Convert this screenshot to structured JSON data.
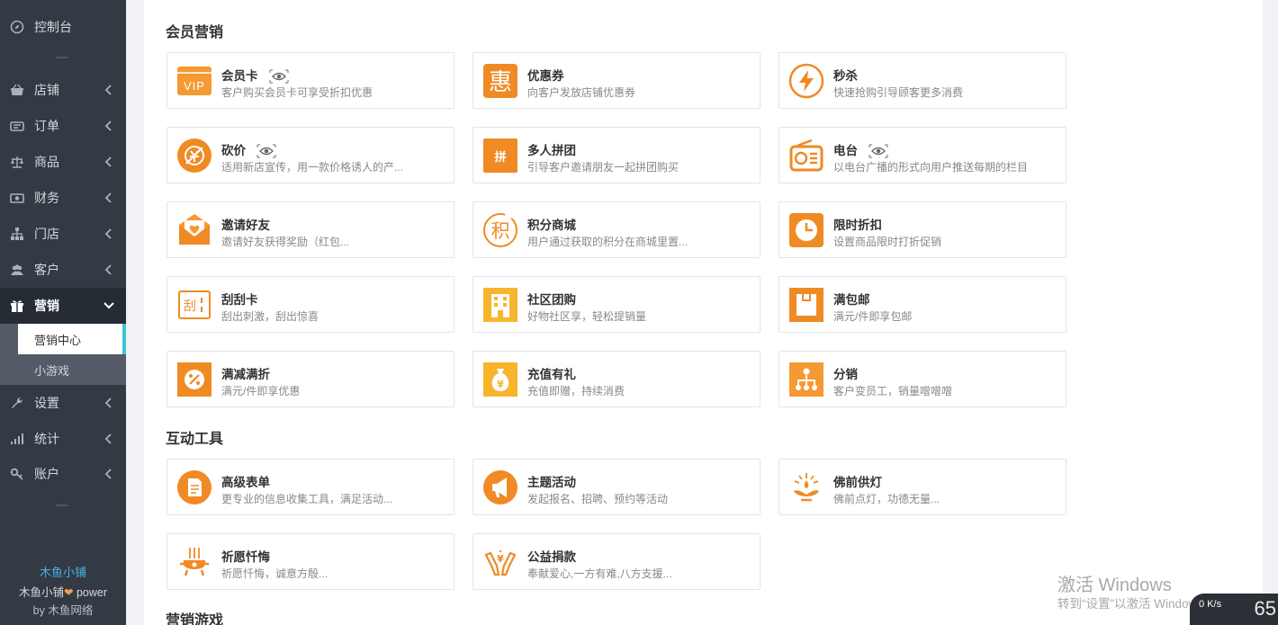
{
  "sidebar": {
    "dashboard": "控制台",
    "items": [
      {
        "label": "店铺"
      },
      {
        "label": "订单"
      },
      {
        "label": "商品"
      },
      {
        "label": "财务"
      },
      {
        "label": "门店"
      },
      {
        "label": "客户"
      },
      {
        "label": "营销"
      },
      {
        "label": "设置"
      },
      {
        "label": "统计"
      },
      {
        "label": "账户"
      }
    ],
    "sub_items": [
      {
        "label": "营销中心"
      },
      {
        "label": "小游戏"
      }
    ],
    "brand_name": "木鱼小铺",
    "brand_power_prefix": "木鱼小铺",
    "brand_power_suffix": "power",
    "brand_by": "by 木鱼网络"
  },
  "sections": [
    {
      "title": "会员营销"
    },
    {
      "title": "互动工具"
    },
    {
      "title": "营销游戏"
    }
  ],
  "cards": [
    {
      "title": "会员卡",
      "desc": "客户购买会员卡可享受折扣优惠",
      "icon": "vip-icon",
      "color": "#f59a33"
    },
    {
      "title": "优惠券",
      "desc": "向客户发放店铺优惠券",
      "icon": "coupon-icon",
      "color": "#f08a24"
    },
    {
      "title": "秒杀",
      "desc": "快速抢购引导顾客更多消费",
      "icon": "lightning-icon",
      "color": "#f08a24"
    },
    {
      "title": "砍价",
      "desc": "适用新店宣传，用一款价格诱人的产...",
      "icon": "bargain-icon",
      "color": "#f08a24"
    },
    {
      "title": "多人拼团",
      "desc": "引导客户邀请朋友一起拼团购买",
      "icon": "group-buy-icon",
      "color": "#f08a24"
    },
    {
      "title": "电台",
      "desc": "以电台广播的形式向用户推送每期的栏目",
      "icon": "radio-icon",
      "color": "#f08a24"
    },
    {
      "title": "邀请好友",
      "desc": "邀请好友获得奖励（红包...",
      "icon": "invite-icon",
      "color": "#f59a33"
    },
    {
      "title": "积分商城",
      "desc": "用户通过获取的积分在商城里置...",
      "icon": "points-icon",
      "color": "#f08a24"
    },
    {
      "title": "限时折扣",
      "desc": "设置商品限时打折促销",
      "icon": "clock-icon",
      "color": "#f08a24"
    },
    {
      "title": "刮刮卡",
      "desc": "刮出刺激，刮出惊喜",
      "icon": "scratch-card-icon",
      "color": "#f08a24"
    },
    {
      "title": "社区团购",
      "desc": "好物社区享，轻松提销量",
      "icon": "building-icon",
      "color": "#f7b52c"
    },
    {
      "title": "满包邮",
      "desc": "满元/件即享包邮",
      "icon": "package-icon",
      "color": "#f08a24"
    },
    {
      "title": "满减满折",
      "desc": "满元/件即享优惠",
      "icon": "percent-icon",
      "color": "#f08a24"
    },
    {
      "title": "充值有礼",
      "desc": "充值即赠，持续消费",
      "icon": "money-bag-icon",
      "color": "#f7b52c"
    },
    {
      "title": "分销",
      "desc": "客户变员工，销量噌噌噌",
      "icon": "distribution-icon",
      "color": "#f59a33"
    },
    {
      "title": "高级表单",
      "desc": "更专业的信息收集工具，满足活动...",
      "icon": "form-icon",
      "color": "#f08a24"
    },
    {
      "title": "主题活动",
      "desc": "发起报名、招聘、预约等活动",
      "icon": "megaphone-icon",
      "color": "#f08a24"
    },
    {
      "title": "佛前供灯",
      "desc": "佛前点灯，功德无量...",
      "icon": "lotus-lamp-icon",
      "color": "#f08a24"
    },
    {
      "title": "祈愿忏悔",
      "desc": "祈愿忏悔，诚意方殷...",
      "icon": "incense-burner-icon",
      "color": "#f08a24"
    },
    {
      "title": "公益捐款",
      "desc": "奉献爱心,一方有难,八方支援...",
      "icon": "donation-hands-icon",
      "color": "#f08a24"
    }
  ],
  "watermark": {
    "line1": "激活 Windows",
    "line2": "转到“设置”以激活 Windows。"
  },
  "speed_widget": {
    "value": "0",
    "unit": "K/s",
    "big": "65"
  }
}
